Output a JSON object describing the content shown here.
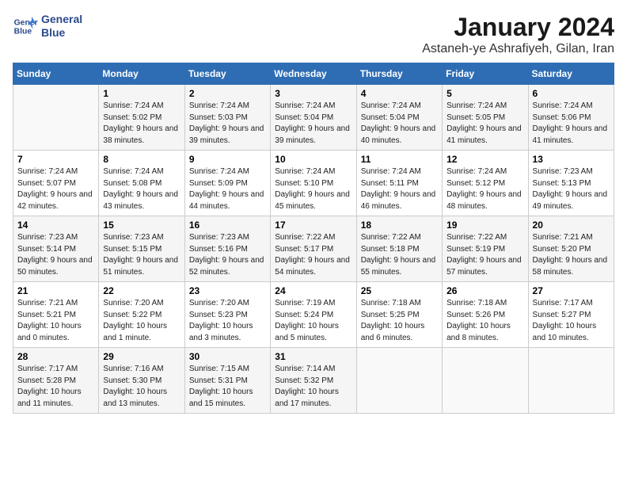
{
  "logo": {
    "line1": "General",
    "line2": "Blue"
  },
  "title": "January 2024",
  "subtitle": "Astaneh-ye Ashrafiyeh, Gilan, Iran",
  "days_of_week": [
    "Sunday",
    "Monday",
    "Tuesday",
    "Wednesday",
    "Thursday",
    "Friday",
    "Saturday"
  ],
  "weeks": [
    [
      {
        "num": "",
        "sunrise": "",
        "sunset": "",
        "daylight": ""
      },
      {
        "num": "1",
        "sunrise": "Sunrise: 7:24 AM",
        "sunset": "Sunset: 5:02 PM",
        "daylight": "Daylight: 9 hours and 38 minutes."
      },
      {
        "num": "2",
        "sunrise": "Sunrise: 7:24 AM",
        "sunset": "Sunset: 5:03 PM",
        "daylight": "Daylight: 9 hours and 39 minutes."
      },
      {
        "num": "3",
        "sunrise": "Sunrise: 7:24 AM",
        "sunset": "Sunset: 5:04 PM",
        "daylight": "Daylight: 9 hours and 39 minutes."
      },
      {
        "num": "4",
        "sunrise": "Sunrise: 7:24 AM",
        "sunset": "Sunset: 5:04 PM",
        "daylight": "Daylight: 9 hours and 40 minutes."
      },
      {
        "num": "5",
        "sunrise": "Sunrise: 7:24 AM",
        "sunset": "Sunset: 5:05 PM",
        "daylight": "Daylight: 9 hours and 41 minutes."
      },
      {
        "num": "6",
        "sunrise": "Sunrise: 7:24 AM",
        "sunset": "Sunset: 5:06 PM",
        "daylight": "Daylight: 9 hours and 41 minutes."
      }
    ],
    [
      {
        "num": "7",
        "sunrise": "Sunrise: 7:24 AM",
        "sunset": "Sunset: 5:07 PM",
        "daylight": "Daylight: 9 hours and 42 minutes."
      },
      {
        "num": "8",
        "sunrise": "Sunrise: 7:24 AM",
        "sunset": "Sunset: 5:08 PM",
        "daylight": "Daylight: 9 hours and 43 minutes."
      },
      {
        "num": "9",
        "sunrise": "Sunrise: 7:24 AM",
        "sunset": "Sunset: 5:09 PM",
        "daylight": "Daylight: 9 hours and 44 minutes."
      },
      {
        "num": "10",
        "sunrise": "Sunrise: 7:24 AM",
        "sunset": "Sunset: 5:10 PM",
        "daylight": "Daylight: 9 hours and 45 minutes."
      },
      {
        "num": "11",
        "sunrise": "Sunrise: 7:24 AM",
        "sunset": "Sunset: 5:11 PM",
        "daylight": "Daylight: 9 hours and 46 minutes."
      },
      {
        "num": "12",
        "sunrise": "Sunrise: 7:24 AM",
        "sunset": "Sunset: 5:12 PM",
        "daylight": "Daylight: 9 hours and 48 minutes."
      },
      {
        "num": "13",
        "sunrise": "Sunrise: 7:23 AM",
        "sunset": "Sunset: 5:13 PM",
        "daylight": "Daylight: 9 hours and 49 minutes."
      }
    ],
    [
      {
        "num": "14",
        "sunrise": "Sunrise: 7:23 AM",
        "sunset": "Sunset: 5:14 PM",
        "daylight": "Daylight: 9 hours and 50 minutes."
      },
      {
        "num": "15",
        "sunrise": "Sunrise: 7:23 AM",
        "sunset": "Sunset: 5:15 PM",
        "daylight": "Daylight: 9 hours and 51 minutes."
      },
      {
        "num": "16",
        "sunrise": "Sunrise: 7:23 AM",
        "sunset": "Sunset: 5:16 PM",
        "daylight": "Daylight: 9 hours and 52 minutes."
      },
      {
        "num": "17",
        "sunrise": "Sunrise: 7:22 AM",
        "sunset": "Sunset: 5:17 PM",
        "daylight": "Daylight: 9 hours and 54 minutes."
      },
      {
        "num": "18",
        "sunrise": "Sunrise: 7:22 AM",
        "sunset": "Sunset: 5:18 PM",
        "daylight": "Daylight: 9 hours and 55 minutes."
      },
      {
        "num": "19",
        "sunrise": "Sunrise: 7:22 AM",
        "sunset": "Sunset: 5:19 PM",
        "daylight": "Daylight: 9 hours and 57 minutes."
      },
      {
        "num": "20",
        "sunrise": "Sunrise: 7:21 AM",
        "sunset": "Sunset: 5:20 PM",
        "daylight": "Daylight: 9 hours and 58 minutes."
      }
    ],
    [
      {
        "num": "21",
        "sunrise": "Sunrise: 7:21 AM",
        "sunset": "Sunset: 5:21 PM",
        "daylight": "Daylight: 10 hours and 0 minutes."
      },
      {
        "num": "22",
        "sunrise": "Sunrise: 7:20 AM",
        "sunset": "Sunset: 5:22 PM",
        "daylight": "Daylight: 10 hours and 1 minute."
      },
      {
        "num": "23",
        "sunrise": "Sunrise: 7:20 AM",
        "sunset": "Sunset: 5:23 PM",
        "daylight": "Daylight: 10 hours and 3 minutes."
      },
      {
        "num": "24",
        "sunrise": "Sunrise: 7:19 AM",
        "sunset": "Sunset: 5:24 PM",
        "daylight": "Daylight: 10 hours and 5 minutes."
      },
      {
        "num": "25",
        "sunrise": "Sunrise: 7:18 AM",
        "sunset": "Sunset: 5:25 PM",
        "daylight": "Daylight: 10 hours and 6 minutes."
      },
      {
        "num": "26",
        "sunrise": "Sunrise: 7:18 AM",
        "sunset": "Sunset: 5:26 PM",
        "daylight": "Daylight: 10 hours and 8 minutes."
      },
      {
        "num": "27",
        "sunrise": "Sunrise: 7:17 AM",
        "sunset": "Sunset: 5:27 PM",
        "daylight": "Daylight: 10 hours and 10 minutes."
      }
    ],
    [
      {
        "num": "28",
        "sunrise": "Sunrise: 7:17 AM",
        "sunset": "Sunset: 5:28 PM",
        "daylight": "Daylight: 10 hours and 11 minutes."
      },
      {
        "num": "29",
        "sunrise": "Sunrise: 7:16 AM",
        "sunset": "Sunset: 5:30 PM",
        "daylight": "Daylight: 10 hours and 13 minutes."
      },
      {
        "num": "30",
        "sunrise": "Sunrise: 7:15 AM",
        "sunset": "Sunset: 5:31 PM",
        "daylight": "Daylight: 10 hours and 15 minutes."
      },
      {
        "num": "31",
        "sunrise": "Sunrise: 7:14 AM",
        "sunset": "Sunset: 5:32 PM",
        "daylight": "Daylight: 10 hours and 17 minutes."
      },
      {
        "num": "",
        "sunrise": "",
        "sunset": "",
        "daylight": ""
      },
      {
        "num": "",
        "sunrise": "",
        "sunset": "",
        "daylight": ""
      },
      {
        "num": "",
        "sunrise": "",
        "sunset": "",
        "daylight": ""
      }
    ]
  ]
}
